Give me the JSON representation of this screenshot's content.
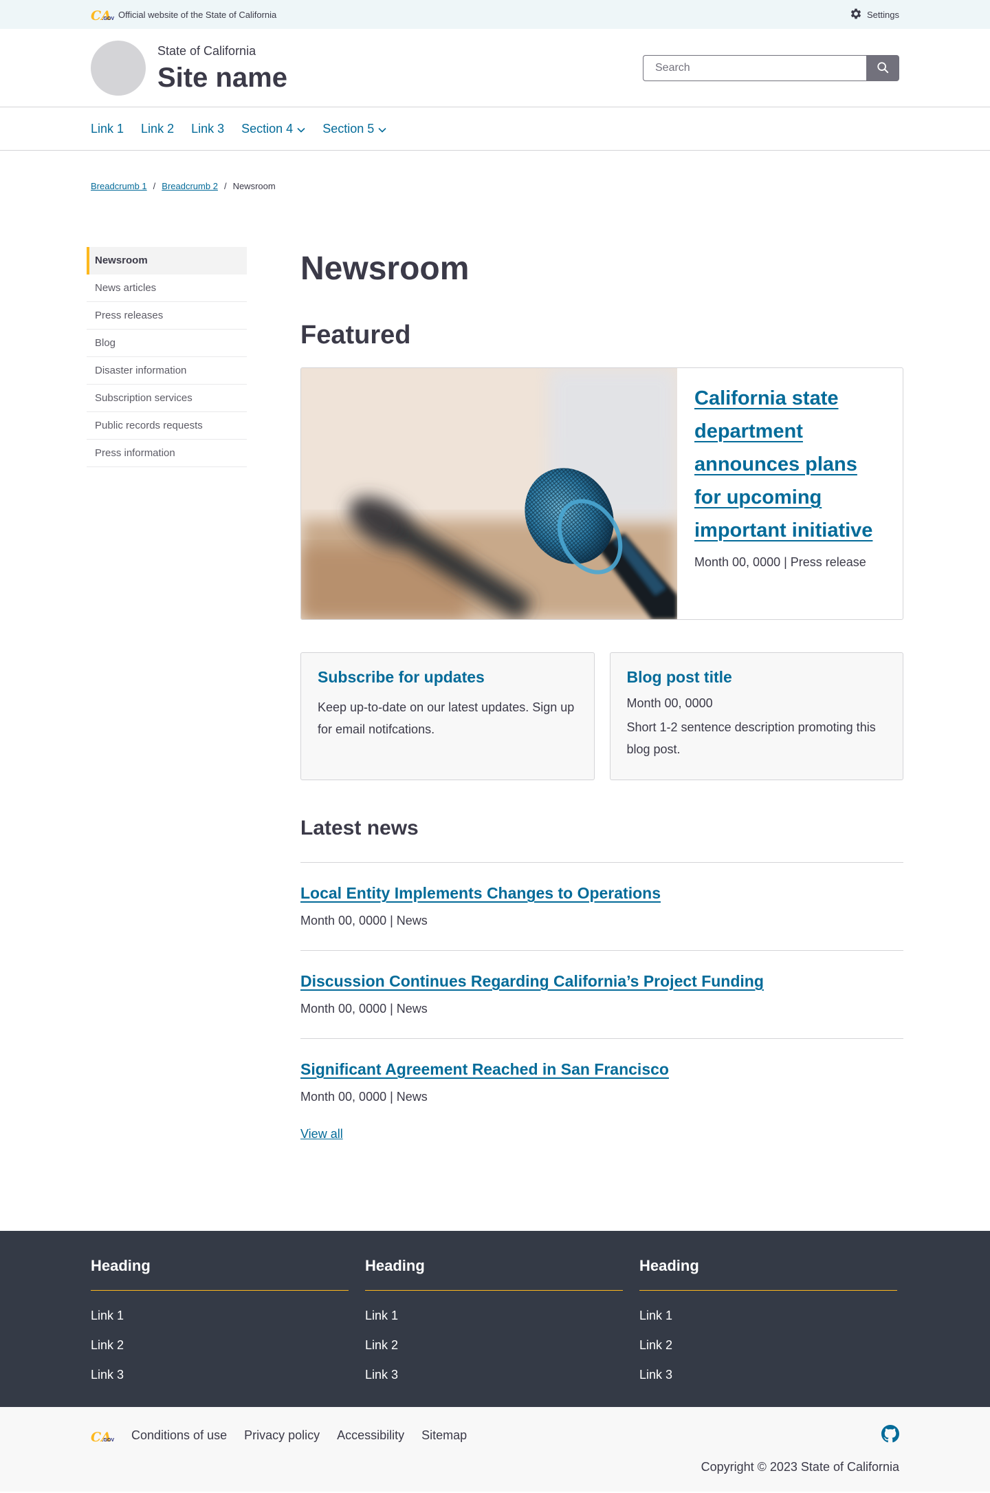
{
  "utility": {
    "logo_text_ca": "CA",
    "logo_text_gov": ".GOV",
    "official_text": "Official website of the State of California",
    "settings_label": "Settings",
    "settings_icon": "gear-icon"
  },
  "branding": {
    "state_name": "State of California",
    "site_name": "Site name",
    "search_placeholder": "Search",
    "search_icon": "search-icon"
  },
  "nav": {
    "items": [
      {
        "label": "Link 1"
      },
      {
        "label": "Link 2"
      },
      {
        "label": "Link 3"
      },
      {
        "label": "Section 4",
        "icon": "chevron-down-icon"
      },
      {
        "label": "Section 5",
        "icon": "chevron-down-icon"
      }
    ]
  },
  "breadcrumb": {
    "items": [
      "Breadcrumb 1",
      "Breadcrumb 2"
    ],
    "separator": "/",
    "current": "Newsroom"
  },
  "sidenav": {
    "items": [
      "Newsroom",
      "News articles",
      "Press releases",
      "Blog",
      "Disaster information",
      "Subscription services",
      "Public records requests",
      "Press information"
    ],
    "active_index": 0
  },
  "main": {
    "page_title": "Newsroom",
    "featured_heading": "Featured",
    "featured": {
      "title": "California state department announces plans for upcoming important initiative",
      "meta": "Month 00, 0000 | Press release",
      "image": "microphone-photo"
    },
    "cards": [
      {
        "title": "Subscribe for updates",
        "body": "Keep up-to-date on our latest updates. Sign up for email notifcations."
      },
      {
        "title": "Blog post title",
        "date": "Month 00, 0000",
        "body": "Short 1-2 sentence description promoting this blog post."
      }
    ],
    "latest_heading": "Latest news",
    "news": [
      {
        "title": "Local Entity Implements Changes to Operations",
        "meta": "Month 00, 0000 | News"
      },
      {
        "title": "Discussion Continues Regarding California’s Project Funding",
        "meta": "Month 00, 0000 | News"
      },
      {
        "title": "Significant Agreement Reached in San Francisco",
        "meta": "Month 00, 0000 | News"
      }
    ],
    "view_all": "View all"
  },
  "footer": {
    "columns": [
      {
        "heading": "Heading",
        "links": [
          "Link 1",
          "Link 2",
          "Link 3"
        ]
      },
      {
        "heading": "Heading",
        "links": [
          "Link 1",
          "Link 2",
          "Link 3"
        ]
      },
      {
        "heading": "Heading",
        "links": [
          "Link 1",
          "Link 2",
          "Link 3"
        ]
      }
    ]
  },
  "bottom": {
    "links": [
      "Conditions of use",
      "Privacy policy",
      "Accessibility",
      "Sitemap"
    ],
    "github_icon": "github-icon",
    "copyright": "Copyright © 2023 State of California"
  },
  "colors": {
    "link": "#046b99",
    "accent": "#fdb81e",
    "footer_bg": "#343a46",
    "utility_bg": "#eef6f8"
  }
}
